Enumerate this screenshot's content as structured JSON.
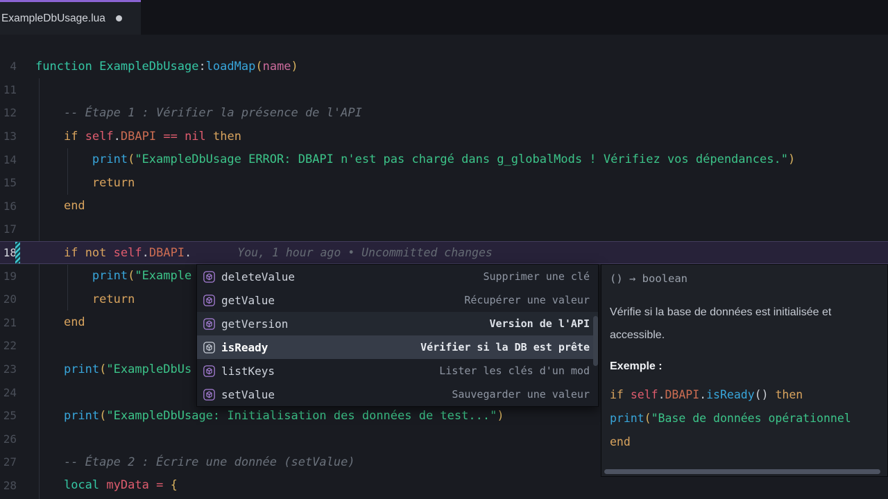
{
  "window": {
    "tab": {
      "title": "ExampleDbUsage.lua",
      "modified_dot": "●"
    }
  },
  "editor": {
    "blame_annotation": "You, 1 hour ago • Uncommitted changes",
    "lines": [
      {
        "num": "4",
        "indent": 0,
        "tokens": [
          [
            "kw",
            "function"
          ],
          [
            "plain",
            " "
          ],
          [
            "kw",
            "ExampleDbUsage"
          ],
          [
            "punc",
            ":"
          ],
          [
            "fn",
            "loadMap"
          ],
          [
            "paren",
            "("
          ],
          [
            "param",
            "name"
          ],
          [
            "paren",
            ")"
          ]
        ]
      },
      {
        "num": "11",
        "indent": 0,
        "tokens": []
      },
      {
        "num": "12",
        "indent": 1,
        "tokens": [
          [
            "comment",
            "-- Étape 1 : Vérifier la présence de l'API"
          ]
        ]
      },
      {
        "num": "13",
        "indent": 1,
        "tokens": [
          [
            "ctrl",
            "if"
          ],
          [
            "plain",
            " "
          ],
          [
            "red",
            "self"
          ],
          [
            "punc",
            "."
          ],
          [
            "prop",
            "DBAPI"
          ],
          [
            "plain",
            " "
          ],
          [
            "red",
            "=="
          ],
          [
            "plain",
            " "
          ],
          [
            "red",
            "nil"
          ],
          [
            "plain",
            " "
          ],
          [
            "ctrl",
            "then"
          ]
        ]
      },
      {
        "num": "14",
        "indent": 2,
        "tokens": [
          [
            "fn",
            "print"
          ],
          [
            "paren",
            "("
          ],
          [
            "str",
            "\"ExampleDbUsage ERROR: DBAPI n'est pas chargé dans g_globalMods ! Vérifiez vos dépendances.\""
          ],
          [
            "paren",
            ")"
          ]
        ]
      },
      {
        "num": "15",
        "indent": 2,
        "tokens": [
          [
            "ctrl",
            "return"
          ]
        ]
      },
      {
        "num": "16",
        "indent": 1,
        "tokens": [
          [
            "ctrl",
            "end"
          ]
        ]
      },
      {
        "num": "17",
        "indent": 0,
        "tokens": []
      },
      {
        "num": "18",
        "indent": 1,
        "active": true,
        "modified": true,
        "blame": true,
        "tokens": [
          [
            "ctrl",
            "if"
          ],
          [
            "plain",
            " "
          ],
          [
            "ctrl",
            "not"
          ],
          [
            "plain",
            " "
          ],
          [
            "red",
            "self"
          ],
          [
            "punc",
            "."
          ],
          [
            "prop",
            "DBAPI"
          ],
          [
            "punc",
            "."
          ]
        ]
      },
      {
        "num": "19",
        "indent": 2,
        "tokens": [
          [
            "fn",
            "print"
          ],
          [
            "paren",
            "("
          ],
          [
            "str",
            "\"Example"
          ]
        ]
      },
      {
        "num": "20",
        "indent": 2,
        "tokens": [
          [
            "ctrl",
            "return"
          ]
        ]
      },
      {
        "num": "21",
        "indent": 1,
        "tokens": [
          [
            "ctrl",
            "end"
          ]
        ]
      },
      {
        "num": "22",
        "indent": 0,
        "tokens": []
      },
      {
        "num": "23",
        "indent": 1,
        "tokens": [
          [
            "fn",
            "print"
          ],
          [
            "paren",
            "("
          ],
          [
            "str",
            "\"ExampleDbUs"
          ]
        ]
      },
      {
        "num": "24",
        "indent": 0,
        "tokens": []
      },
      {
        "num": "25",
        "indent": 1,
        "tokens": [
          [
            "fn",
            "print"
          ],
          [
            "paren",
            "("
          ],
          [
            "str",
            "\"ExampleDbUsage: Initialisation des données de test...\""
          ],
          [
            "paren",
            ")"
          ]
        ]
      },
      {
        "num": "26",
        "indent": 0,
        "tokens": []
      },
      {
        "num": "27",
        "indent": 1,
        "tokens": [
          [
            "comment",
            "-- Étape 2 : Écrire une donnée (setValue)"
          ]
        ]
      },
      {
        "num": "28",
        "indent": 1,
        "tokens": [
          [
            "kw",
            "local"
          ],
          [
            "plain",
            " "
          ],
          [
            "red",
            "myData"
          ],
          [
            "plain",
            " "
          ],
          [
            "red",
            "="
          ],
          [
            "plain",
            " "
          ],
          [
            "paren",
            "{"
          ]
        ]
      }
    ]
  },
  "suggest": {
    "icon_name": "method-cube-icon",
    "items": [
      {
        "label": "deleteValue",
        "detail": "Supprimer une clé",
        "state": ""
      },
      {
        "label": "getValue",
        "detail": "Récupérer une valeur",
        "state": ""
      },
      {
        "label": "getVersion",
        "detail": "Version de l'API",
        "state": "hover"
      },
      {
        "label": "isReady",
        "detail": "Vérifier si la DB est prête",
        "state": "selected"
      },
      {
        "label": "listKeys",
        "detail": "Lister les clés d'un mod",
        "state": ""
      },
      {
        "label": "setValue",
        "detail": "Sauvegarder une valeur",
        "state": ""
      }
    ]
  },
  "docs": {
    "signature": "() → boolean",
    "description": "Vérifie si la base de données est initialisée et accessible.",
    "example_label": "Exemple :",
    "example_lines": [
      {
        "indent": 0,
        "tokens": [
          [
            "ctrl",
            "if"
          ],
          [
            "plain",
            " "
          ],
          [
            "red",
            "self"
          ],
          [
            "punc",
            "."
          ],
          [
            "prop",
            "DBAPI"
          ],
          [
            "punc",
            "."
          ],
          [
            "fn",
            "isReady"
          ],
          [
            "punc",
            "()"
          ],
          [
            "plain",
            " "
          ],
          [
            "ctrl",
            "then"
          ]
        ]
      },
      {
        "indent": 1,
        "tokens": [
          [
            "fn",
            "print"
          ],
          [
            "paren",
            "("
          ],
          [
            "str",
            "\"Base de données opérationnel"
          ]
        ]
      },
      {
        "indent": 0,
        "tokens": [
          [
            "ctrl",
            "end"
          ]
        ]
      }
    ]
  },
  "colors": {
    "tab_accent_purple": "#8a63d2",
    "editor_background": "#191b21",
    "keyword_teal": "#35c7a4",
    "control_keyword_gold": "#d9a45e",
    "string_green": "#3cc489",
    "function_blue": "#38a6db",
    "variable_red": "#e05c6e",
    "property_orange": "#cd6d52",
    "parameter_pink": "#cc6b9c",
    "bracket_gold": "#d9b25f",
    "comment_gray": "#6a717b",
    "method_icon_purple": "#a87fd8",
    "modified_marker_teal": "#3ec6cf",
    "active_line_purple": "#272239",
    "selected_suggestion_bg": "#363c48"
  }
}
